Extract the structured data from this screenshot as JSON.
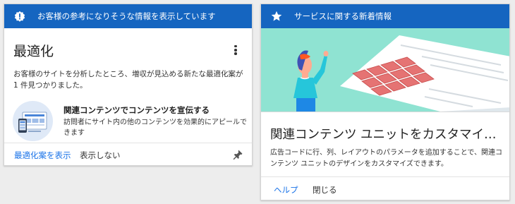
{
  "left_card": {
    "header_icon": "alert-badge-icon",
    "header_text": "お客様の参考になりそうな情報を表示しています",
    "title": "最適化",
    "description": "お客様のサイトを分析したところ、増収が見込める新たな最適化案が 1 件見つかりました。",
    "recommendation": {
      "title": "関連コンテンツでコンテンツを宣伝する",
      "description": "訪問者にサイト内の他のコンテンツを効果的にアピールできます"
    },
    "actions": {
      "show": "最適化案を表示",
      "dismiss": "表示しない"
    }
  },
  "right_card": {
    "header_icon": "star-icon",
    "header_text": "サービスに関する新着情報",
    "title": "関連コンテンツ ユニットをカスタマイ…",
    "description": "広告コードに行、列、レイアウトのパラメータを追加することで、関連コンテンツ ユニットのデザインをカスタマイズできます。",
    "actions": {
      "help": "ヘルプ",
      "close": "閉じる"
    }
  },
  "colors": {
    "header_bg": "#1565c0",
    "link": "#1a73e8",
    "hero_bg": "#8fe3d2",
    "page_bg": "#ededed"
  }
}
